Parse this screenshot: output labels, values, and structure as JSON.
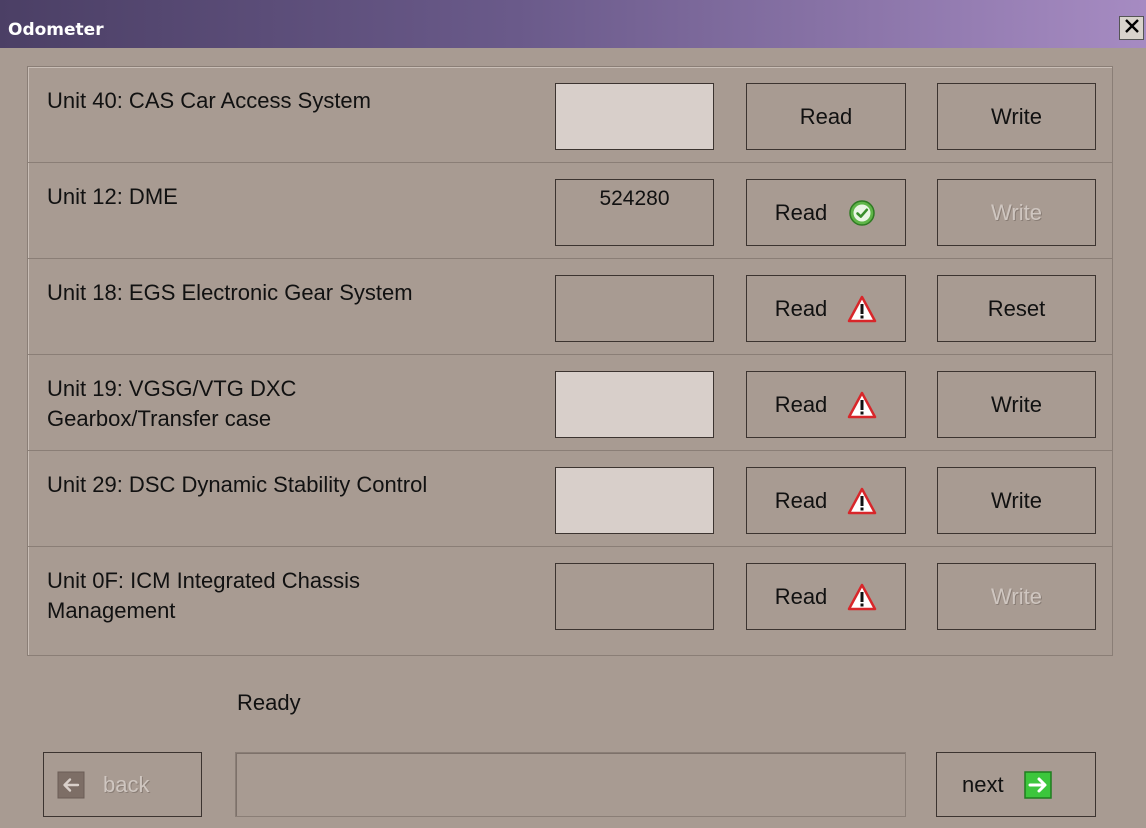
{
  "window": {
    "title": "Odometer",
    "close_icon": "close-icon"
  },
  "units": [
    {
      "label": "Unit 40: CAS Car Access System",
      "value": "",
      "read_label": "Read",
      "read_status": "",
      "action_label": "Write",
      "action_enabled": true,
      "value_shade": "light"
    },
    {
      "label": "Unit 12: DME",
      "value": "524280",
      "read_label": "Read",
      "read_status": "success-check-icon",
      "action_label": "Write",
      "action_enabled": false,
      "value_shade": "dark"
    },
    {
      "label": "Unit 18: EGS Electronic Gear System",
      "value": "",
      "read_label": "Read",
      "read_status": "warning-icon",
      "action_label": "Reset",
      "action_enabled": true,
      "value_shade": "dark"
    },
    {
      "label": "Unit 19: VGSG/VTG DXC\nGearbox/Transfer case",
      "value": "",
      "read_label": "Read",
      "read_status": "warning-icon",
      "action_label": "Write",
      "action_enabled": true,
      "value_shade": "light"
    },
    {
      "label": "Unit 29: DSC Dynamic Stability Control",
      "value": "",
      "read_label": "Read",
      "read_status": "warning-icon",
      "action_label": "Write",
      "action_enabled": true,
      "value_shade": "light"
    },
    {
      "label": "Unit 0F: ICM Integrated Chassis\nManagement",
      "value": "",
      "read_label": "Read",
      "read_status": "warning-icon",
      "action_label": "Write",
      "action_enabled": false,
      "value_shade": "dark"
    }
  ],
  "status": {
    "text": "Ready"
  },
  "nav": {
    "back_label": "back",
    "back_enabled": false,
    "back_icon": "arrow-left-icon",
    "next_label": "next",
    "next_enabled": true,
    "next_icon": "arrow-right-icon"
  },
  "colors": {
    "background": "#a89b92",
    "titlebar_start": "#4b3f65",
    "titlebar_end": "#a68bc2",
    "success_green": "#5fb548",
    "warning_red": "#d8262a",
    "next_arrow_green": "#3cc63c"
  }
}
